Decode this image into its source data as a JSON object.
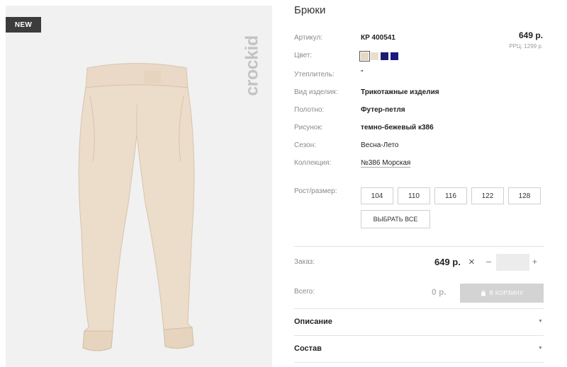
{
  "photo": {
    "badge": "NEW",
    "brand": "crockid",
    "alt": "Product photo"
  },
  "product": {
    "title": "Брюки",
    "price": "649 р.",
    "rrp": "РРЦ: 1299 р.",
    "attrs": [
      {
        "label": "Артикул:",
        "value": "КР 400541"
      },
      {
        "label": "Цвет:",
        "value": ""
      },
      {
        "label": "Утеплитель:",
        "value": "\""
      },
      {
        "label": "Вид изделия:",
        "value": "Трикотажные изделия"
      },
      {
        "label": "Полотно:",
        "value": "Футер-петля"
      },
      {
        "label": "Рисунок:",
        "value": "темно-бежевый к386"
      },
      {
        "label": "Сезон:",
        "value": "Весна-Лето"
      },
      {
        "label": "Коллекция:",
        "value": "№386 Морская"
      }
    ],
    "colors": [
      "#e4d8c4",
      "#e9dfcd",
      "#1d1d6e",
      "#18187e"
    ],
    "size_label": "Рост/размер:",
    "sizes": [
      "104",
      "110",
      "116",
      "122",
      "128"
    ],
    "select_all": "ВЫБРАТЬ ВСЕ"
  },
  "order": {
    "label": "Заказ:",
    "price": "649 р.",
    "times": "×",
    "minus": "–",
    "plus": "+",
    "qty": "",
    "total_label": "Всего:",
    "total_value": "0 р.",
    "cart_button": "В КОРЗИНУ"
  },
  "accordions": [
    {
      "label": "Описание"
    },
    {
      "label": "Состав"
    }
  ],
  "icons": {
    "cart": "cart-icon",
    "arrow": "chevron-down-icon"
  }
}
